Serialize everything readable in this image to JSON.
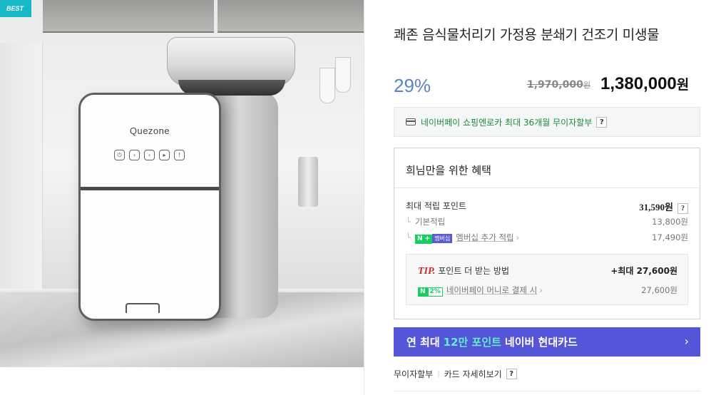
{
  "image": {
    "badge": "BEST",
    "brand_on_device": "Quezone"
  },
  "product": {
    "title": "쾌존 음식물처리기 가정용 분쇄기 건조기 미생물",
    "discount": "29%",
    "original_price": "1,970,000",
    "original_unit": "원",
    "sale_price": "1,380,000",
    "sale_unit": "원"
  },
  "npay": {
    "text": "네이버페이 쇼핑엔로카 최대 36개월 무이자할부",
    "help": "?"
  },
  "benefit": {
    "title": "희님만을 위한 혜택",
    "max_points_label": "최대 적립 포인트",
    "max_points_value": "31,590원",
    "help": "?",
    "basic_label": "기본적립",
    "basic_value": "13,800원",
    "membership_badge_n": "N +",
    "membership_badge": "멤버십",
    "membership_label": "멤버십 추가 적립",
    "membership_value": "17,490원",
    "tip": {
      "label": "TIP.",
      "text": "포인트 더 받는 방법",
      "value": "+최대 27,600원",
      "badge_n": "N",
      "badge_pct": "2%",
      "sub_label": "네이버페이 머니로 결제 시",
      "sub_value": "27,600원"
    }
  },
  "card_banner": {
    "prefix": "연 최대",
    "highlight": "12만 포인트",
    "suffix": "네이버 현대카드",
    "chevron": "›"
  },
  "footer": {
    "installment": "무이자할부",
    "card_detail": "카드 자세히보기",
    "help": "?"
  },
  "colors": {
    "discount": "#5d83c7",
    "npay_green": "#1f8a3a",
    "banner": "#5555d9",
    "banner_highlight": "#5ff0d0",
    "tip_red": "#c8282e",
    "best_badge": "#16b8c6"
  }
}
